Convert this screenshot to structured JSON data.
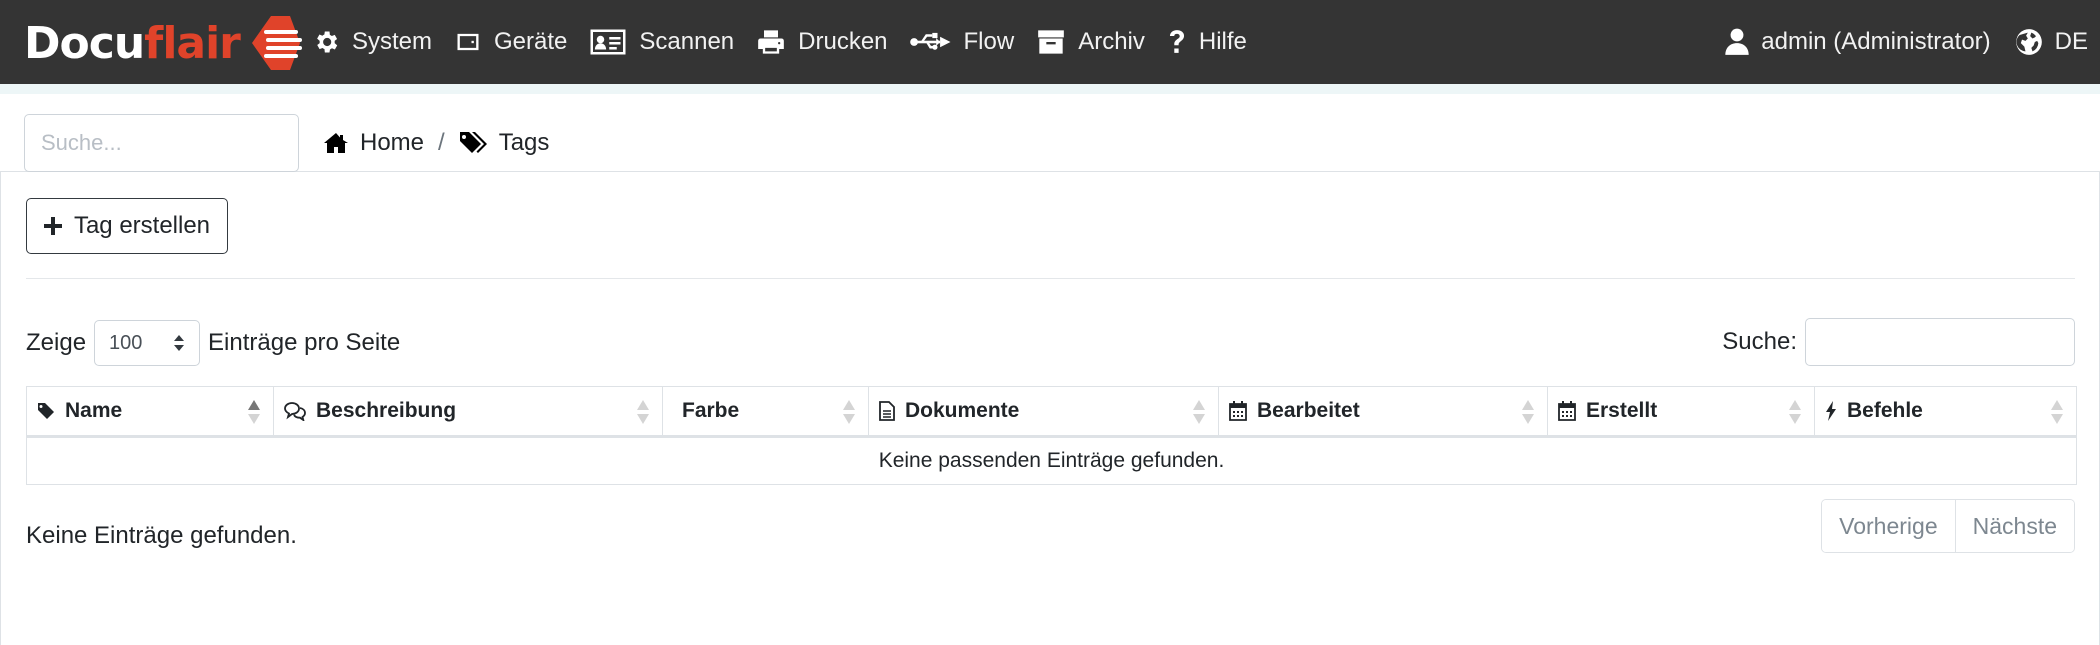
{
  "brand": {
    "part1": "Docu",
    "part2": "flair"
  },
  "nav": {
    "items": [
      {
        "label": "System",
        "icon": "gear-icon"
      },
      {
        "label": "Geräte",
        "icon": "device-icon"
      },
      {
        "label": "Scannen",
        "icon": "id-card-icon"
      },
      {
        "label": "Drucken",
        "icon": "printer-icon"
      },
      {
        "label": "Flow",
        "icon": "usb-icon"
      },
      {
        "label": "Archiv",
        "icon": "archive-icon"
      },
      {
        "label": "Hilfe",
        "icon": "question-icon"
      }
    ],
    "user": "admin (Administrator)",
    "language": "DE"
  },
  "search": {
    "placeholder": "Suche..."
  },
  "breadcrumb": {
    "home": "Home",
    "sep": "/",
    "current": "Tags"
  },
  "toolbar": {
    "create_label": "Tag erstellen"
  },
  "table_controls": {
    "show_prefix": "Zeige",
    "page_length": "100",
    "show_suffix": "Einträge pro Seite",
    "filter_label": "Suche:"
  },
  "table": {
    "columns": [
      {
        "label": "Name",
        "icon": "tag-icon"
      },
      {
        "label": "Beschreibung",
        "icon": "comments-icon"
      },
      {
        "label": "Farbe",
        "icon": ""
      },
      {
        "label": "Dokumente",
        "icon": "file-icon"
      },
      {
        "label": "Bearbeitet",
        "icon": "calendar-icon"
      },
      {
        "label": "Erstellt",
        "icon": "calendar-icon"
      },
      {
        "label": "Befehle",
        "icon": "bolt-icon"
      }
    ],
    "empty_message": "Keine passenden Einträge gefunden."
  },
  "footer": {
    "info": "Keine Einträge gefunden.",
    "prev": "Vorherige",
    "next": "Nächste"
  },
  "colors": {
    "navbar": "#343434",
    "brand_accent": "#e0432a"
  }
}
